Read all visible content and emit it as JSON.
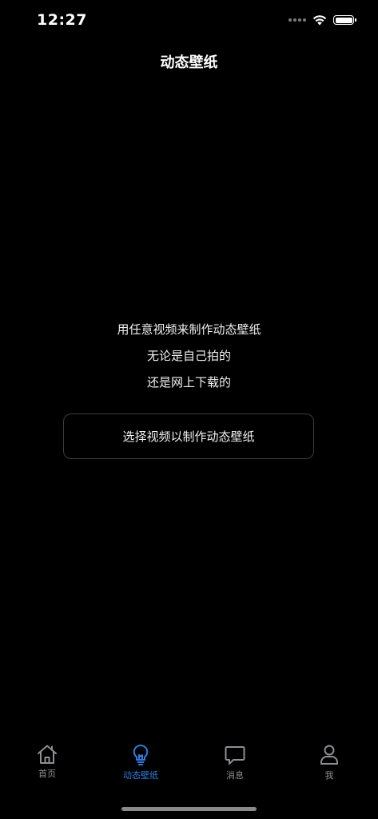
{
  "status_bar": {
    "time": "12:27",
    "battery_level": 1.0
  },
  "header": {
    "title": "动态壁纸"
  },
  "main": {
    "intro_lines": [
      "用任意视频来制作动态壁纸",
      "无论是自己拍的",
      "还是网上下载的"
    ],
    "select_button_label": "选择视频以制作动态壁纸"
  },
  "tab_bar": {
    "active_color": "#2f7de0",
    "inactive_color": "#8e8e93",
    "tabs": [
      {
        "label": "首页",
        "icon": "home-icon",
        "active": false
      },
      {
        "label": "动态壁纸",
        "icon": "lightbulb-icon",
        "active": true
      },
      {
        "label": "消息",
        "icon": "chat-bubble-icon",
        "active": false
      },
      {
        "label": "我",
        "icon": "person-icon",
        "active": false
      }
    ]
  }
}
